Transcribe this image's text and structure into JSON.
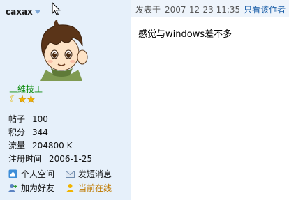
{
  "user": {
    "name": "caxax",
    "title": "三維技工",
    "stats": [
      {
        "key": "帖子",
        "value": "100"
      },
      {
        "key": "积分",
        "value": "344"
      },
      {
        "key": "流量",
        "value": "204800 K"
      },
      {
        "key": "注册时间",
        "value": "2006-1-25"
      }
    ],
    "links": {
      "profile": "个人空间",
      "message": "发短消息",
      "add_friend": "加为好友",
      "online": "当前在线"
    },
    "rank_icons": [
      "moon-icon",
      "star-icon",
      "star-icon"
    ]
  },
  "post": {
    "posted_label": "发表于",
    "timestamp": "2007-12-23 11:35",
    "only_author": "只看该作者",
    "body": "感觉与windows差不多"
  },
  "colors": {
    "sidebar_bg": "#e6f0fa",
    "link_blue": "#1a5ea8",
    "title_green": "#0a8a0a",
    "online_orange": "#c07a00"
  }
}
